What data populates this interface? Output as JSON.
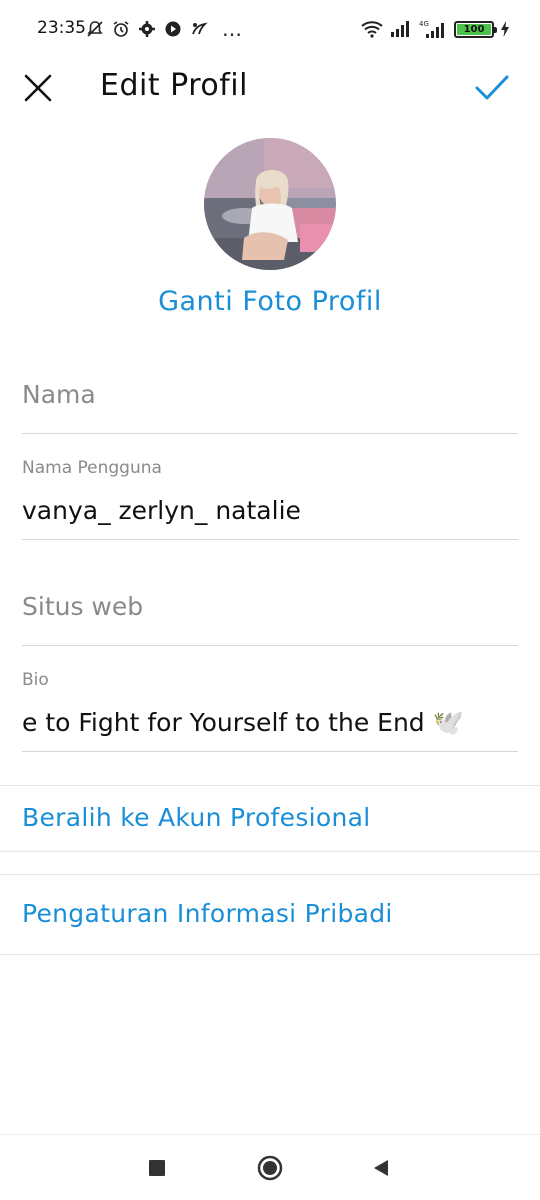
{
  "status_bar": {
    "time": "23:35",
    "more": "…",
    "battery": "100",
    "icons_left": [
      "mute-notification-icon",
      "alarm-icon",
      "gear-icon",
      "media-play-icon",
      "notification-app-icon"
    ],
    "icons_right": [
      "wifi-icon",
      "signal-icon",
      "signal-4g-icon",
      "battery-icon",
      "charging-icon"
    ]
  },
  "header": {
    "title": "Edit Profil",
    "close_icon": "close-icon",
    "confirm_icon": "check-icon"
  },
  "profile": {
    "change_photo_label": "Ganti Foto Profil"
  },
  "fields": {
    "name": {
      "placeholder": "Nama",
      "value": ""
    },
    "username": {
      "label": "Nama Pengguna",
      "value": "vanya_ zerlyn_ natalie"
    },
    "website": {
      "placeholder": "Situs web",
      "value": ""
    },
    "bio": {
      "label": "Bio",
      "value": "e to Fight for Yourself to the End 🕊️"
    }
  },
  "links": {
    "professional": "Beralih ke Akun Profesional",
    "personal_info": "Pengaturan Informasi Pribadi"
  },
  "nav": {
    "recents": "square-icon",
    "home": "circle-icon",
    "back": "triangle-back-icon"
  },
  "colors": {
    "accent": "#1a8fd8",
    "text": "#111111",
    "muted": "#8a8a8a",
    "divider": "#d6d6d6",
    "battery": "#4cc24a"
  }
}
